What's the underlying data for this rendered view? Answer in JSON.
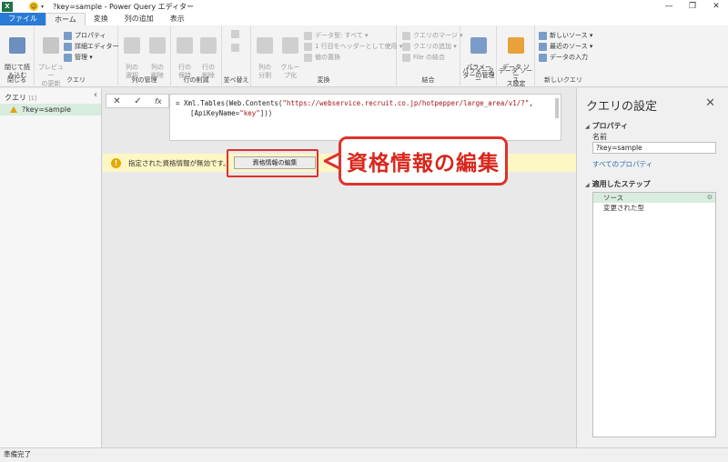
{
  "window": {
    "title": "?key=sample - Power Query エディター",
    "excel_logo": "X"
  },
  "tabs": [
    {
      "label": "ファイル"
    },
    {
      "label": "ホーム"
    },
    {
      "label": "変換"
    },
    {
      "label": "列の追加"
    },
    {
      "label": "表示"
    }
  ],
  "ribbon": {
    "close": {
      "btn": "閉じて読\nみ込む",
      "group": "閉じる"
    },
    "query": {
      "preview": "プレビュー\nの更新",
      "properties": "プロパティ",
      "advanced": "詳細エディター",
      "manage": "管理",
      "group": "クエリ"
    },
    "columns": {
      "select": "列の\n選択",
      "remove": "列の\n削除",
      "group": "列の管理"
    },
    "rows": {
      "keep": "行の\n保持",
      "remove": "行の\n削除",
      "group": "行の削減"
    },
    "sort": {
      "group": "並べ替え"
    },
    "transform": {
      "split": "列の\n分割",
      "group_by": "グルー\nプ化",
      "data_type": "データ型: すべて",
      "header": "1 行目をヘッダーとして使用",
      "replace": "値の置換",
      "group": "変換"
    },
    "combine": {
      "merge": "クエリのマージ",
      "append": "クエリの追加",
      "files": "File の結合",
      "group": "結合"
    },
    "params": {
      "manage": "パラメー\nターの管理",
      "group": "パラメーター"
    },
    "datasource": {
      "settings": "データ ソー\nス設定",
      "group": "データ ソース"
    },
    "newquery": {
      "new_source": "新しいソース",
      "recent": "最近のソース",
      "enter": "データの入力",
      "group": "新しいクエリ"
    }
  },
  "left_panel": {
    "header": "クエリ",
    "count": "[1]",
    "items": [
      {
        "label": "?key=sample",
        "status": "warning"
      }
    ]
  },
  "formula_bar": {
    "cancel": "✕",
    "commit": "✓",
    "fx": "fx",
    "prefix": "= Xml.Tables(Web.Contents(",
    "url": "\"https://webservice.recruit.co.jp/hotpepper/large_area/v1/?\"",
    "suffix": ",",
    "line2_a": "[ApiKeyName=",
    "line2_key": "\"key\"",
    "line2_b": "]))"
  },
  "warning": {
    "icon": "!",
    "message": "指定された資格情報が無効です。",
    "button": "資格情報の編集"
  },
  "callout": {
    "text": "資格情報の編集"
  },
  "right_panel": {
    "title": "クエリの設定",
    "close": "✕",
    "properties_header": "プロパティ",
    "name_label": "名前",
    "name_value": "?key=sample",
    "all_properties": "すべてのプロパティ",
    "applied_steps_header": "適用したステップ",
    "steps": [
      "ソース",
      "変更された型"
    ]
  },
  "statusbar": {
    "text": "準備完了"
  },
  "colors": {
    "accent": "#2a7bd6",
    "selected": "#d8ecdf",
    "warning_bg": "#fdf7c4",
    "callout_red": "#e0312b"
  }
}
